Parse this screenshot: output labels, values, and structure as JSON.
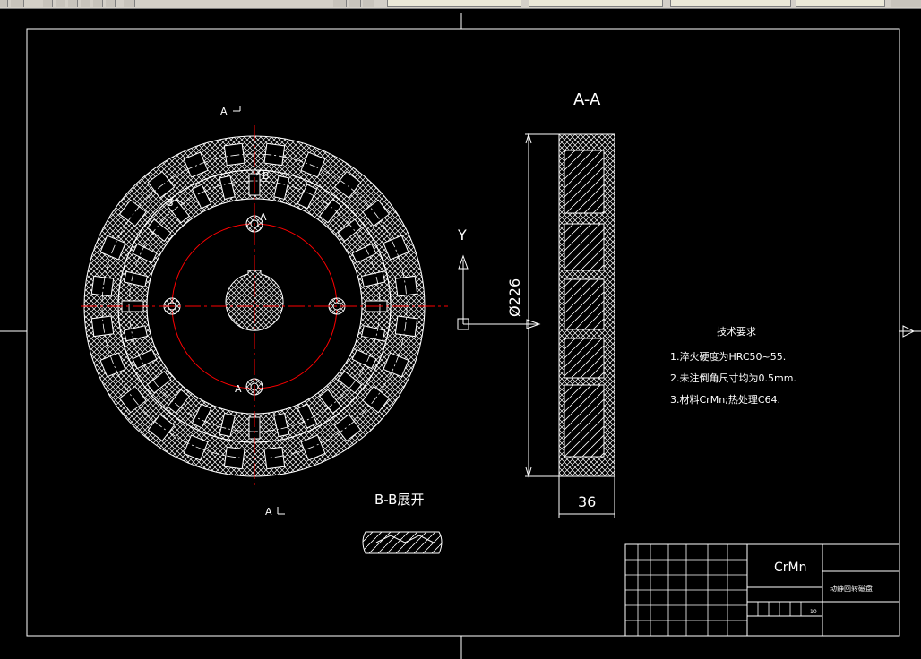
{
  "app": {
    "toolbar_tabs": [
      "",
      "",
      "",
      "",
      ""
    ]
  },
  "drawing": {
    "section_label_aa": "A-A",
    "diameter_dim": "Ø226",
    "width_dim": "36",
    "axis_label_y": "Y",
    "view_bb_label": "B-B展开",
    "marker_a_top": "A",
    "marker_a_bottom": "A",
    "marker_a_inner_top": "A",
    "marker_a_inner_bottom": "A",
    "marker_b_left": "B",
    "marker_b_right": "B"
  },
  "tech_requirements": {
    "heading": "技术要求",
    "items": [
      "1.淬火硬度为HRC50~55.",
      "2.未注倒角尺寸均为0.5mm.",
      "3.材料CrMn;热处理C64."
    ]
  },
  "title_block": {
    "material": "CrMn",
    "part_name": "动静回转磁盘",
    "sheet_number": "10"
  },
  "colors": {
    "background": "#000000",
    "lines": "#ffffff",
    "centerlines": "#ff0000"
  }
}
